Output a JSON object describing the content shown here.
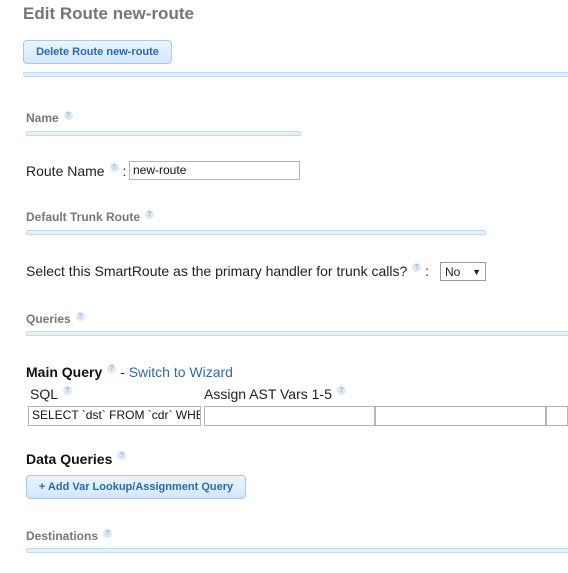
{
  "page": {
    "title": "Edit Route new-route"
  },
  "toolbar": {
    "delete_label": "Delete Route new-route"
  },
  "sections": {
    "name": "Name",
    "default_trunk": "Default Trunk Route",
    "queries": "Queries",
    "destinations": "Destinations"
  },
  "route_name": {
    "label": "Route Name",
    "separator": ":",
    "value": "new-route"
  },
  "primary_handler": {
    "label": "Select this SmartRoute as the primary handler for trunk calls?",
    "separator": ":",
    "value": "No"
  },
  "main_query": {
    "title": "Main Query",
    "separator": " - ",
    "switch_link": "Switch to Wizard",
    "sql_header": "SQL",
    "vars_header": "Assign AST Vars 1-5",
    "sql_value": "SELECT `dst` FROM `cdr` WHERE",
    "vars_values": [
      "",
      "",
      ""
    ]
  },
  "data_queries": {
    "title": "Data Queries",
    "add_label": "+ Add Var Lookup/Assignment Query"
  },
  "help_icon_glyph": "?"
}
